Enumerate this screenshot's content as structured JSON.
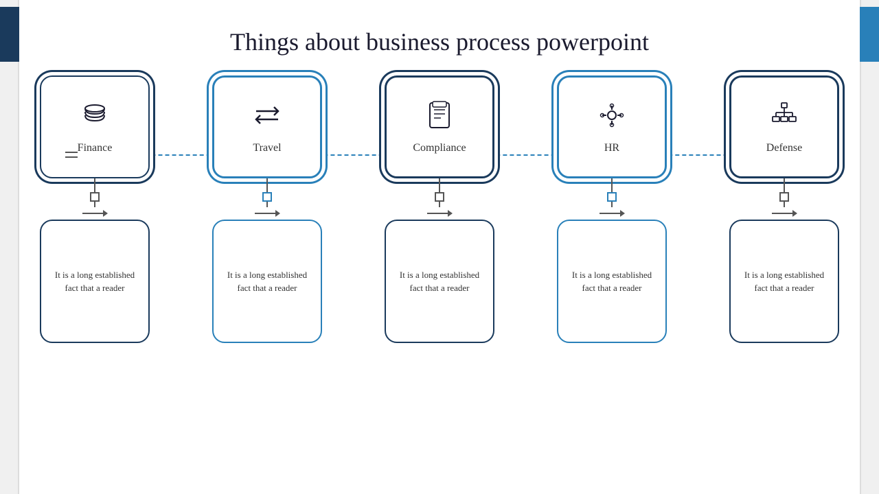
{
  "page": {
    "title": "Things about business process powerpoint"
  },
  "cards": [
    {
      "id": "finance",
      "label": "Finance",
      "icon": "🪙",
      "border_style": "double-border dark",
      "description": "It is a long established fact that a reader"
    },
    {
      "id": "travel",
      "label": "Travel",
      "icon": "⇆",
      "border_style": "double-border-blue",
      "description": "It is a long established fact that a reader"
    },
    {
      "id": "compliance",
      "label": "Compliance",
      "icon": "📄",
      "border_style": "dark",
      "description": "It is a long established fact that a reader"
    },
    {
      "id": "hr",
      "label": "HR",
      "icon": "❖",
      "border_style": "blue",
      "description": "It is a long established fact that a reader"
    },
    {
      "id": "defense",
      "label": "Defense",
      "icon": "🔗",
      "border_style": "dark",
      "description": "It is a long established fact that a reader"
    }
  ]
}
